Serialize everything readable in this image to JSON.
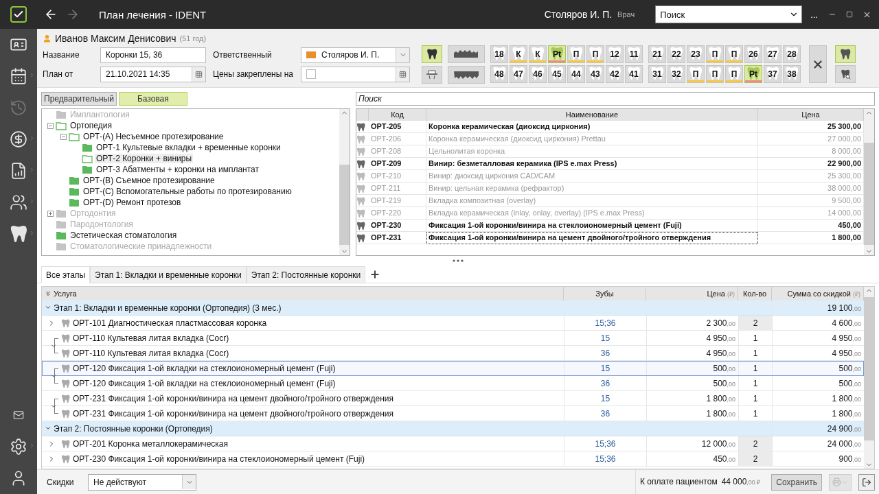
{
  "titlebar": {
    "title": "План лечения  - IDENT",
    "user": "Столяров И. П.",
    "role": "Врач",
    "search_placeholder": "Поиск",
    "more": "..."
  },
  "sidebar": {
    "items": [
      {
        "kind": "card",
        "disabled": false,
        "submenu": false
      },
      {
        "kind": "calendar",
        "disabled": false,
        "submenu": true
      },
      {
        "kind": "history",
        "disabled": true,
        "submenu": false
      },
      {
        "kind": "money",
        "disabled": false,
        "submenu": true
      },
      {
        "kind": "report",
        "disabled": false,
        "submenu": true
      },
      {
        "kind": "people",
        "disabled": false,
        "submenu": true
      },
      {
        "kind": "tooth",
        "disabled": false,
        "submenu": true
      }
    ],
    "bottom": [
      {
        "kind": "mail",
        "disabled": false,
        "submenu": false
      },
      {
        "kind": "settings",
        "disabled": false,
        "submenu": true
      },
      {
        "kind": "user",
        "disabled": false,
        "submenu": false
      }
    ]
  },
  "patient": {
    "name": "Иванов Максим Денисович",
    "age": "(51 год)"
  },
  "form": {
    "name_label": "Название",
    "name_value": "Коронки 15, 36",
    "plan_label": "План от",
    "plan_value": "21.10.2021 14:35",
    "responsible_label": "Ответственный",
    "responsible_value": "Столяров И. П.",
    "prices_label": "Цены закреплены на",
    "prices_checked": false
  },
  "view_buttons": [
    {
      "kind": "tooth",
      "selected": true
    },
    {
      "kind": "jaw-upper",
      "selected": false
    },
    {
      "kind": "bridge",
      "selected": false
    },
    {
      "kind": "jaw-lower",
      "selected": false
    }
  ],
  "teeth": {
    "upper_left": [
      {
        "label": "18",
        "selected": false
      },
      {
        "label": "К",
        "selected": false,
        "color": "#f5c842"
      },
      {
        "label": "К",
        "selected": false,
        "color": "#f5c842"
      },
      {
        "label": "Pt",
        "selected": true,
        "color": "#f08a8a"
      },
      {
        "label": "П",
        "selected": false,
        "color": "#f5c842"
      },
      {
        "label": "П",
        "selected": false,
        "color": "#f5c842"
      },
      {
        "label": "12",
        "selected": false
      },
      {
        "label": "11",
        "selected": false
      }
    ],
    "upper_right": [
      {
        "label": "21",
        "selected": false
      },
      {
        "label": "22",
        "selected": false
      },
      {
        "label": "23",
        "selected": false
      },
      {
        "label": "П",
        "selected": false,
        "color": "#f5c842"
      },
      {
        "label": "П",
        "selected": false,
        "color": "#f5c842"
      },
      {
        "label": "26",
        "selected": false
      },
      {
        "label": "27",
        "selected": false
      },
      {
        "label": "28",
        "selected": false
      }
    ],
    "lower_left": [
      {
        "label": "48",
        "selected": false
      },
      {
        "label": "47",
        "selected": false
      },
      {
        "label": "46",
        "selected": false
      },
      {
        "label": "45",
        "selected": false
      },
      {
        "label": "44",
        "selected": false
      },
      {
        "label": "43",
        "selected": false
      },
      {
        "label": "42",
        "selected": false
      },
      {
        "label": "41",
        "selected": false
      }
    ],
    "lower_right": [
      {
        "label": "31",
        "selected": false
      },
      {
        "label": "32",
        "selected": false
      },
      {
        "label": "П",
        "selected": false,
        "color": "#f5c842"
      },
      {
        "label": "П",
        "selected": false,
        "color": "#f5c842"
      },
      {
        "label": "П",
        "selected": false,
        "color": "#f5c842"
      },
      {
        "label": "Pt",
        "selected": true,
        "color": "#f08a8a"
      },
      {
        "label": "37",
        "selected": false
      },
      {
        "label": "38",
        "selected": false
      }
    ]
  },
  "chart_tools": [
    {
      "kind": "numbering",
      "selected": true
    },
    {
      "kind": "search",
      "selected": false
    }
  ],
  "price_tabs": [
    {
      "label": "Предварительный",
      "selected": false
    },
    {
      "label": "Базовая",
      "selected": true
    }
  ],
  "tree": [
    {
      "label": "Имплантология",
      "open": false,
      "disabled": true,
      "selected": false
    },
    {
      "label": "Ортопедия",
      "open": true,
      "disabled": false,
      "selected": false,
      "expanded": true,
      "children": [
        {
          "label": "ОРТ-(A) Несъемное протезирование",
          "open": true,
          "disabled": false,
          "selected": false,
          "expanded": true,
          "children": [
            {
              "label": "ОРТ-1 Культевые вкладки + временные коронки",
              "open": false,
              "disabled": false,
              "selected": false
            },
            {
              "label": "ОРТ-2 Коронки + виниры",
              "open": true,
              "disabled": false,
              "selected": true
            },
            {
              "label": "ОРТ-3 Абатменты + коронки на имплантат",
              "open": false,
              "disabled": false,
              "selected": false
            }
          ]
        },
        {
          "label": "ОРТ-(B) Съемное протезирование",
          "open": false,
          "disabled": false,
          "selected": false
        },
        {
          "label": "ОРТ-(C) Вспомогательные работы по протезированию",
          "open": false,
          "disabled": false,
          "selected": false
        },
        {
          "label": "ОРТ-(D) Ремонт протезов",
          "open": false,
          "disabled": false,
          "selected": false
        }
      ]
    },
    {
      "label": "Ортодонтия",
      "open": false,
      "disabled": true,
      "selected": false,
      "expanded": false
    },
    {
      "label": "Пародонтология",
      "open": false,
      "disabled": true,
      "selected": false
    },
    {
      "label": "Эстетическая стоматология",
      "open": false,
      "disabled": false,
      "selected": false
    },
    {
      "label": "Стоматологические принадлежности",
      "open": false,
      "disabled": true,
      "selected": false
    }
  ],
  "catalog": {
    "search_placeholder": "Поиск",
    "columns": [
      "Код",
      "Наименование",
      "Цена"
    ],
    "rows": [
      {
        "code": "ОРТ-205",
        "name": "Коронка керамическая (диоксид циркония)",
        "price": "25 300,00",
        "disabled": false,
        "selected": false
      },
      {
        "code": "ОРТ-206",
        "name": "Коронка керамическая (диоксид циркония) Prettau",
        "price": "27 000,00",
        "disabled": true,
        "selected": false
      },
      {
        "code": "ОРТ-208",
        "name": "Цельнолитая коронка",
        "price": "8 000,00",
        "disabled": true,
        "selected": false
      },
      {
        "code": "ОРТ-209",
        "name": "Винир: безметалловая керамика (IPS e.max Press)",
        "price": "22 900,00",
        "disabled": false,
        "selected": false
      },
      {
        "code": "ОРТ-210",
        "name": "Винир: диоксид циркония CAD/CAM",
        "price": "25 300,00",
        "disabled": true,
        "selected": false
      },
      {
        "code": "ОРТ-211",
        "name": "Винир: цельная керамика (рефрактор)",
        "price": "38 000,00",
        "disabled": true,
        "selected": false
      },
      {
        "code": "ОРТ-219",
        "name": "Вкладка композитная (overlay)",
        "price": "9 500,00",
        "disabled": true,
        "selected": false
      },
      {
        "code": "ОРТ-220",
        "name": "Вкладка керамическая (inlay, onlay, overlay) (IPS e.max Press)",
        "price": "14 000,00",
        "disabled": true,
        "selected": false
      },
      {
        "code": "ОРТ-230",
        "name": "Фиксация 1-ой коронки/винира на стеклоиономерный цемент (Fuji)",
        "price": "450,00",
        "disabled": false,
        "selected": false
      },
      {
        "code": "ОРТ-231",
        "name": "Фиксация 1-ой коронки/винира на цемент двойного/тройного отверждения",
        "price": "1 800,00",
        "disabled": false,
        "selected": true
      }
    ]
  },
  "stage_tabs": [
    {
      "label": "Все этапы",
      "selected": true
    },
    {
      "label": "Этап 1: Вкладки и временные коронки",
      "selected": false
    },
    {
      "label": "Этап 2: Постоянные коронки",
      "selected": false
    }
  ],
  "plan": {
    "columns": {
      "service": "Услуга",
      "teeth": "Зубы",
      "price": "Цена",
      "price_unit": "(₽)",
      "qty": "Кол-во",
      "sum": "Сумма со скидкой",
      "sum_unit": "(₽)"
    },
    "groups": [
      {
        "title": "Этап 1: Вкладки и временные коронки (Ортопедия) (3 мес.)",
        "sum": "19 100",
        "sum_cents": ",00",
        "expanded": true,
        "rows": [
          {
            "kind": "expandable",
            "service": "ОРТ-101 Диагностическая пластмассовая коронка",
            "teeth": "15;36",
            "price": "2 300",
            "price_cents": ",00",
            "qty": "2",
            "sum": "4 600",
            "sum_cents": ",00",
            "selected": false
          },
          {
            "kind": "link-top",
            "service": "ОРТ-110 Культевая литая вкладка (Cocr)",
            "teeth": "15",
            "price": "4 950",
            "price_cents": ",00",
            "qty": "1",
            "sum": "4 950",
            "sum_cents": ",00",
            "selected": false
          },
          {
            "kind": "link-bottom",
            "service": "ОРТ-110 Культевая литая вкладка (Cocr)",
            "teeth": "36",
            "price": "4 950",
            "price_cents": ",00",
            "qty": "1",
            "sum": "4 950",
            "sum_cents": ",00",
            "selected": false
          },
          {
            "kind": "link-top",
            "service": "ОРТ-120 Фиксация 1-ой вкладки на стеклоиономерный цемент (Fuji)",
            "teeth": "15",
            "price": "500",
            "price_cents": ",00",
            "qty": "1",
            "sum": "500",
            "sum_cents": ",00",
            "selected": true
          },
          {
            "kind": "link-bottom",
            "service": "ОРТ-120 Фиксация 1-ой вкладки на стеклоиономерный цемент (Fuji)",
            "teeth": "36",
            "price": "500",
            "price_cents": ",00",
            "qty": "1",
            "sum": "500",
            "sum_cents": ",00",
            "selected": false
          },
          {
            "kind": "link-top",
            "service": "ОРТ-231 Фиксация 1-ой коронки/винира на цемент двойного/тройного отверждения",
            "teeth": "15",
            "price": "1 800",
            "price_cents": ",00",
            "qty": "1",
            "sum": "1 800",
            "sum_cents": ",00",
            "selected": false
          },
          {
            "kind": "link-bottom",
            "service": "ОРТ-231 Фиксация 1-ой коронки/винира на цемент двойного/тройного отверждения",
            "teeth": "36",
            "price": "1 800",
            "price_cents": ",00",
            "qty": "1",
            "sum": "1 800",
            "sum_cents": ",00",
            "selected": false
          }
        ]
      },
      {
        "title": "Этап 2: Постоянные коронки (Ортопедия)",
        "sum": "24 900",
        "sum_cents": ",00",
        "expanded": true,
        "rows": [
          {
            "kind": "expandable",
            "service": "ОРТ-201 Коронка металлокерамическая",
            "teeth": "15;36",
            "price": "12 000",
            "price_cents": ",00",
            "qty": "2",
            "sum": "24 000",
            "sum_cents": ",00",
            "selected": false
          },
          {
            "kind": "expandable",
            "service": "ОРТ-230 Фиксация 1-ой коронки/винира на стеклоиономерный цемент (Fuji)",
            "teeth": "15;36",
            "price": "450",
            "price_cents": ",00",
            "qty": "2",
            "sum": "900",
            "sum_cents": ",00",
            "selected": false
          }
        ]
      }
    ]
  },
  "footer": {
    "discount_label": "Скидки",
    "discount_value": "Не действуют",
    "total_label": "К оплате пациентом",
    "total": "44 000",
    "total_cents": ",00 ₽",
    "save": "Сохранить"
  }
}
